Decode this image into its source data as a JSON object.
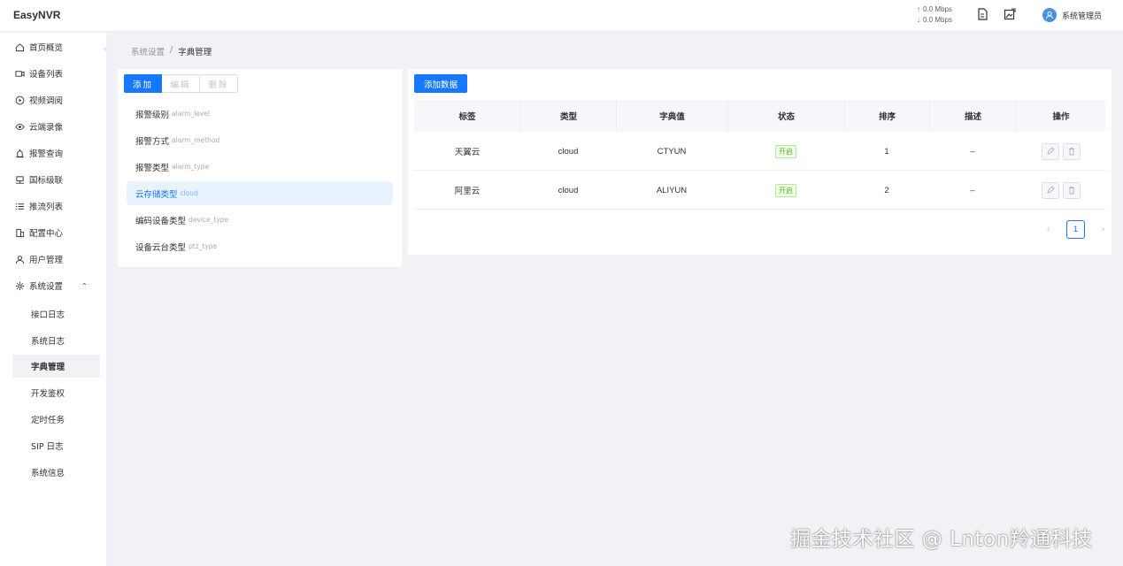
{
  "app": {
    "title": "EasyNVR"
  },
  "header": {
    "upload_speed": "0.0 Mbps",
    "download_speed": "0.0 Mbps",
    "user_name": "系统管理员"
  },
  "sidebar": {
    "items": [
      {
        "label": "首页概览",
        "icon": "home-icon"
      },
      {
        "label": "设备列表",
        "icon": "camera-icon"
      },
      {
        "label": "视频调阅",
        "icon": "play-circle-icon"
      },
      {
        "label": "云端录像",
        "icon": "eye-icon"
      },
      {
        "label": "报警查询",
        "icon": "alarm-icon"
      },
      {
        "label": "国标级联",
        "icon": "cascade-icon"
      },
      {
        "label": "推流列表",
        "icon": "list-icon"
      },
      {
        "label": "配置中心",
        "icon": "building-icon"
      },
      {
        "label": "用户管理",
        "icon": "user-icon"
      },
      {
        "label": "系统设置",
        "icon": "gear-icon"
      }
    ],
    "sub_items": [
      "接口日志",
      "系统日志",
      "字典管理",
      "开发鉴权",
      "定时任务",
      "SIP 日志",
      "系统信息"
    ],
    "active_sub": "字典管理"
  },
  "breadcrumb": {
    "parent": "系统设置",
    "separator": "/",
    "current": "字典管理"
  },
  "dict_panel": {
    "buttons": {
      "add": "添加",
      "edit": "编辑",
      "delete": "删除"
    },
    "items": [
      {
        "label": "报警级别",
        "code": "alarm_level"
      },
      {
        "label": "报警方式",
        "code": "alarm_method"
      },
      {
        "label": "报警类型",
        "code": "alarm_type"
      },
      {
        "label": "云存储类型",
        "code": "cloud"
      },
      {
        "label": "编码设备类型",
        "code": "device_type"
      },
      {
        "label": "设备云台类型",
        "code": "ptz_type"
      }
    ]
  },
  "data_panel": {
    "add_button": "添加数据",
    "columns": [
      "标签",
      "类型",
      "字典值",
      "状态",
      "排序",
      "描述",
      "操作"
    ],
    "rows": [
      {
        "label": "天翼云",
        "type": "cloud",
        "value": "CTYUN",
        "status": "开启",
        "order": "1",
        "desc": "–"
      },
      {
        "label": "阿里云",
        "type": "cloud",
        "value": "ALIYUN",
        "status": "开启",
        "order": "2",
        "desc": "–"
      }
    ],
    "pagination": {
      "current_page": "1",
      "prev": "‹",
      "next": "›"
    }
  },
  "watermark": "掘金技术社区 @ Lnton羚通科技",
  "colors": {
    "primary": "#1677ff",
    "success": "#52c41a",
    "background": "#f0f2f5"
  }
}
